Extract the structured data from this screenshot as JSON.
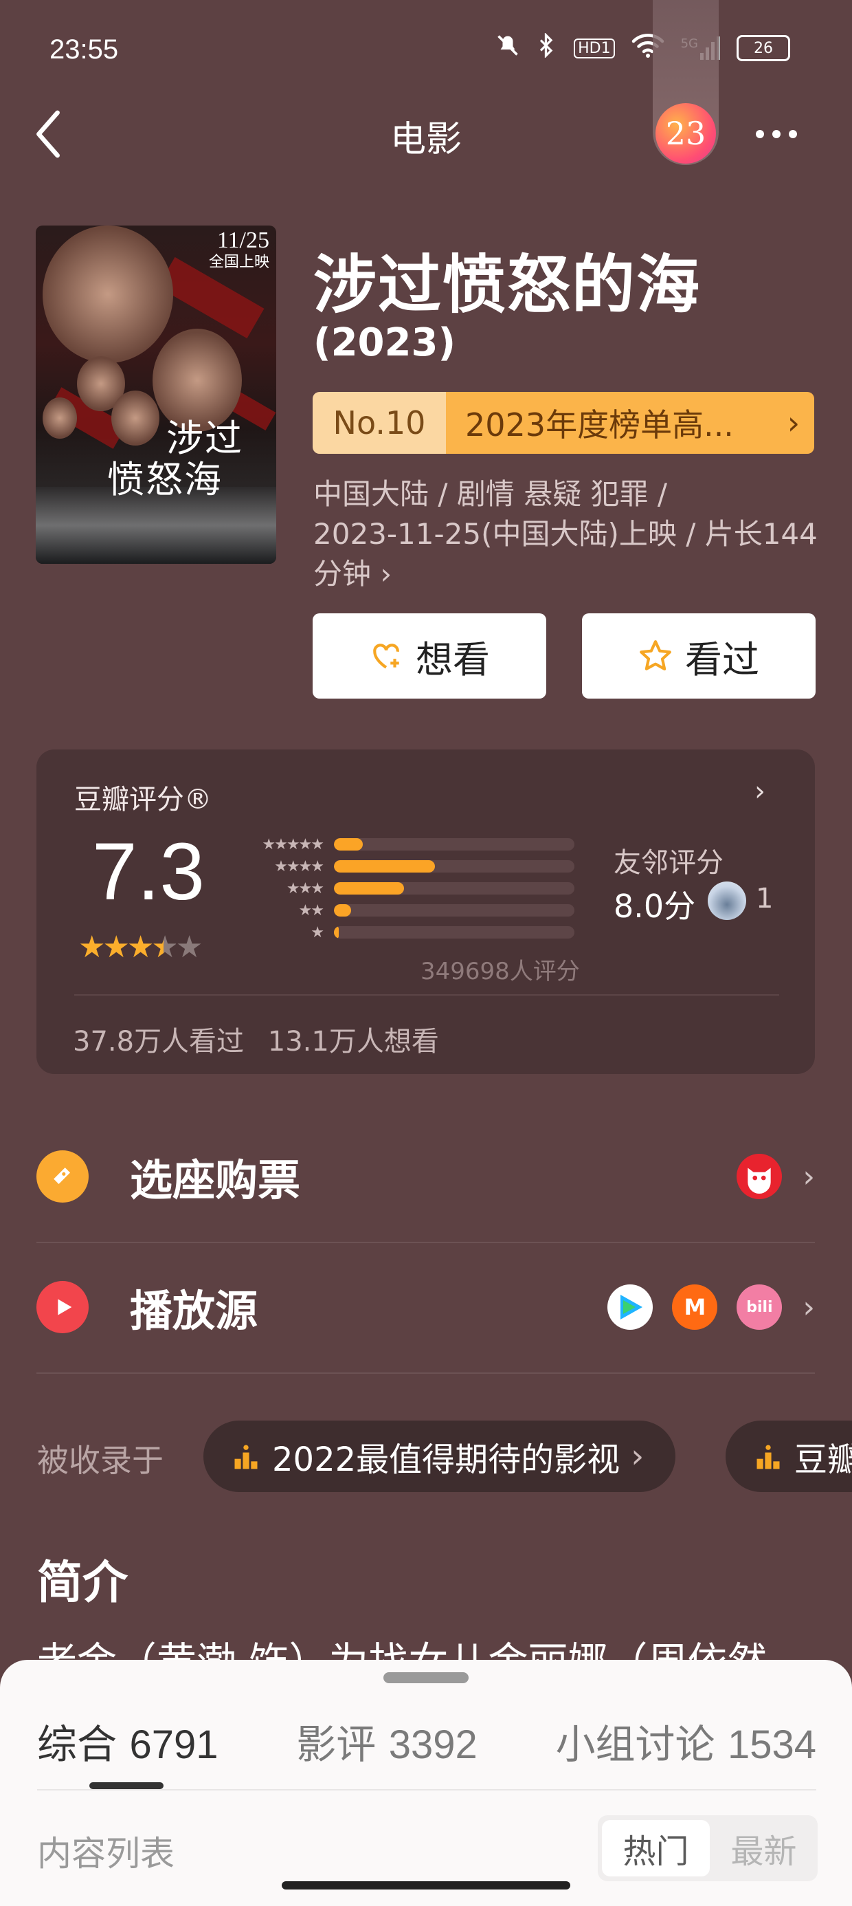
{
  "status_bar": {
    "time": "23:55",
    "battery": "26",
    "network": "5G",
    "hd": "HD1"
  },
  "header": {
    "title": "电影",
    "avatar_text": "23"
  },
  "poster": {
    "date": "11/25",
    "release_note": "全国上映",
    "title_line1": "涉过",
    "title_line2": "愤怒海"
  },
  "movie": {
    "title": "涉过愤怒的海",
    "year": "(2023)",
    "rank_no": "No.10",
    "rank_text": "2023年度榜单高...",
    "meta_line1": "中国大陆 / 剧情 悬疑 犯罪 /",
    "meta_line2": "2023-11-25(中国大陆)上映 / 片长144",
    "meta_line3": "分钟 ›"
  },
  "actions": {
    "want_label": "想看",
    "watched_label": "看过"
  },
  "rating": {
    "label": "豆瓣评分®",
    "score": "7.3",
    "stars": 3.5,
    "distribution": [
      0.12,
      0.42,
      0.29,
      0.07,
      0.02
    ],
    "count_text": "349698人评分",
    "friend_label": "友邻评分",
    "friend_score": "8.0分",
    "friend_count": "1",
    "watched": "37.8万人看过",
    "wishlist": "13.1万人想看"
  },
  "rows": {
    "tickets": "选座购票",
    "sources": "播放源"
  },
  "collections": {
    "label": "被收录于",
    "chip1": "2022最值得期待的影视",
    "chip2": "豆瓣"
  },
  "intro": {
    "title": "简介",
    "peek": "老金（黄渤 饰）为找女儿金丽娜（周依然"
  },
  "sheet": {
    "tab1": "综合",
    "tab1_count": "6791",
    "tab2": "影评",
    "tab2_count": "3392",
    "tab3": "小组讨论",
    "tab3_count": "1534",
    "content_label": "内容列表",
    "sort_hot": "热门",
    "sort_new": "最新"
  },
  "colors": {
    "accent": "#fba426",
    "background": "#5d4143",
    "card": "#4a3436"
  }
}
